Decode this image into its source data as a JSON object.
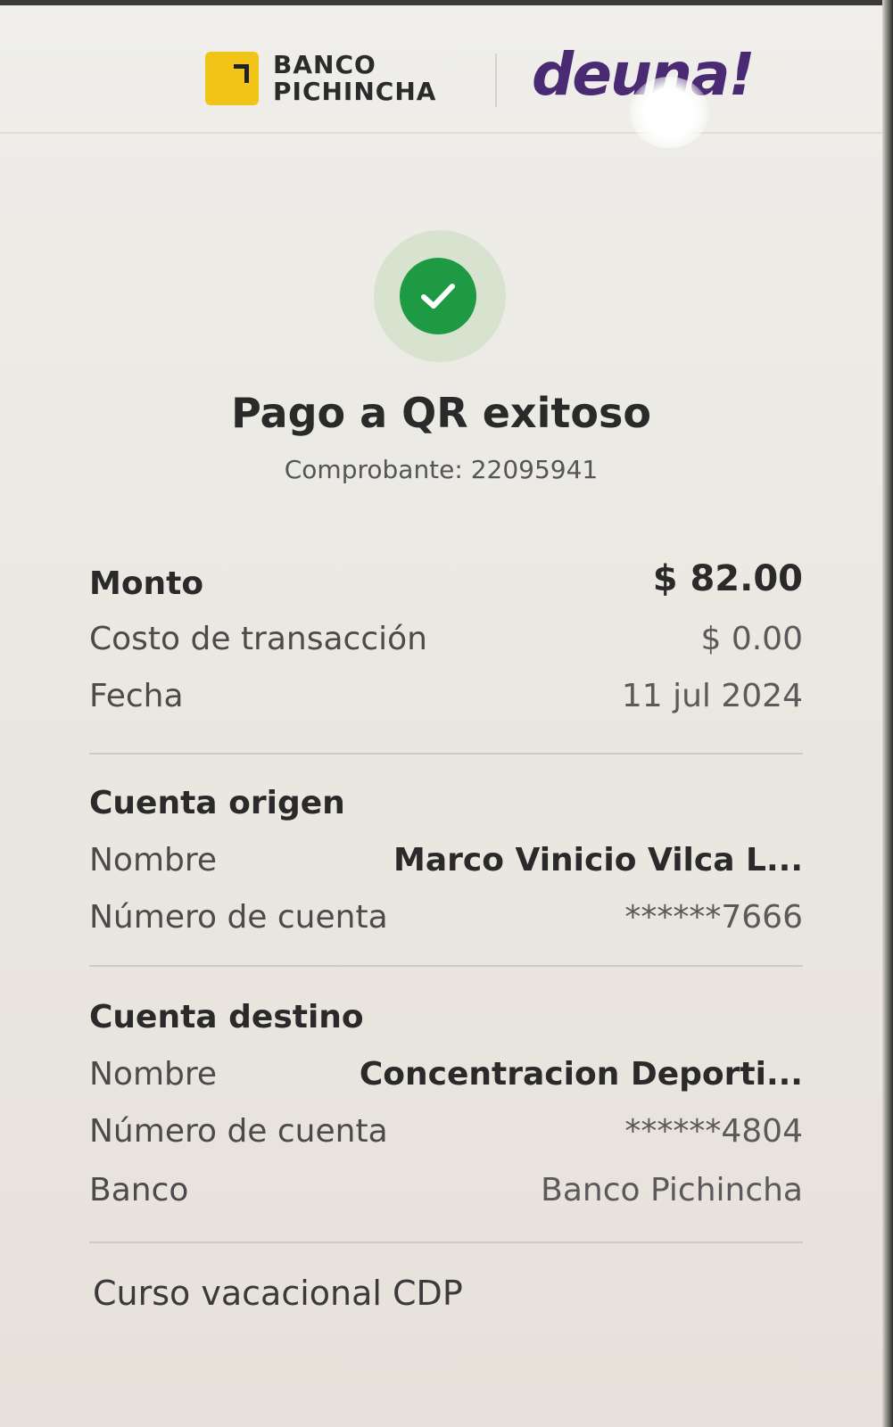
{
  "header": {
    "bank_logo_line1": "BANCO",
    "bank_logo_line2": "PICHINCHA",
    "app_logo_text": "deuna!"
  },
  "status": {
    "icon": "check-circle-icon",
    "title": "Pago a QR exitoso",
    "receipt": "Comprobante: 22095941"
  },
  "summary": {
    "amount_label": "Monto",
    "amount_value": "$ 82.00",
    "fee_label": "Costo de transacción",
    "fee_value": "$ 0.00",
    "date_label": "Fecha",
    "date_value": "11 jul 2024"
  },
  "origin": {
    "section_title": "Cuenta origen",
    "name_label": "Nombre",
    "name_value": "Marco Vinicio Vilca L...",
    "account_label": "Número de cuenta",
    "account_value": "******7666"
  },
  "destination": {
    "section_title": "Cuenta destino",
    "name_label": "Nombre",
    "name_value": "Concentracion Deporti...",
    "account_label": "Número de cuenta",
    "account_value": "******4804",
    "bank_label": "Banco",
    "bank_value": "Banco Pichincha"
  },
  "concept": "Curso vacacional CDP",
  "colors": {
    "success_green": "#1f9a44",
    "brand_yellow": "#f2c418",
    "deuna_purple": "#4a2a72"
  }
}
